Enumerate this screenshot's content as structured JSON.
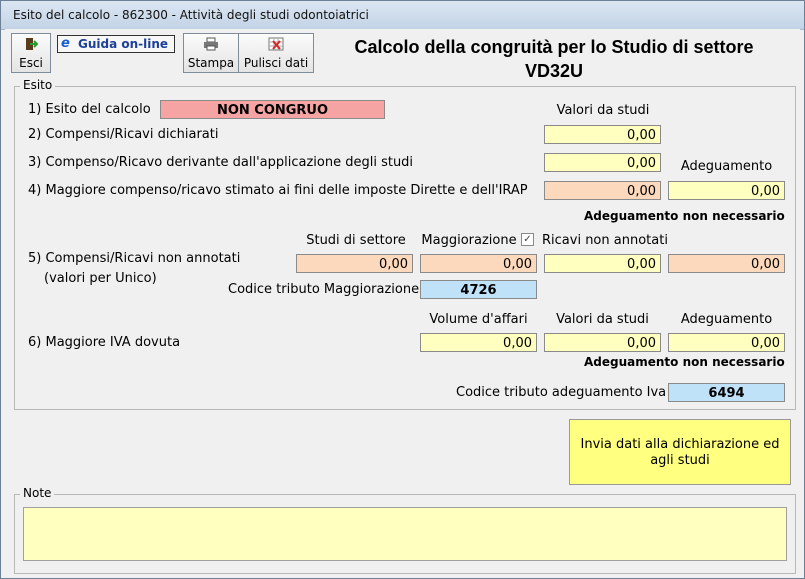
{
  "window": {
    "title": "Esito del calcolo - 862300 - Attività degli studi odontoiatrici"
  },
  "toolbar": {
    "exit_label": "Esci",
    "guide_label": "Guida on-line",
    "print_label": "Stampa",
    "clear_label": "Pulisci dati"
  },
  "heading": {
    "line1": "Calcolo della congruità per lo Studio di settore",
    "line2": "VD32U"
  },
  "esito": {
    "legend": "Esito",
    "row1": {
      "label": "1) Esito del calcolo",
      "value": "NON CONGRUO"
    },
    "valori_header": "Valori da studi",
    "row2": {
      "label": "2) Compensi/Ricavi dichiarati",
      "value": "0,00"
    },
    "row3": {
      "label": "3) Compenso/Ricavo derivante dall'applicazione degli studi",
      "value": "0,00"
    },
    "adeguamento_header": "Adeguamento",
    "row4": {
      "label": "4) Maggiore compenso/ricavo stimato ai fini delle imposte Dirette e dell'IRAP",
      "value": "0,00",
      "adeguamento": "0,00"
    },
    "note_row4": "Adeguamento non necessario",
    "row5": {
      "label_line1": "5) Compensi/Ricavi non annotati",
      "label_line2": "(valori per Unico)",
      "headers": [
        "Studi di settore",
        "Maggiorazione",
        "Ricavi non annotati"
      ],
      "maggiorazione_checked": true,
      "values": [
        "0,00",
        "0,00",
        "0,00",
        "0,00"
      ],
      "codice_label": "Codice tributo Maggiorazione",
      "codice_value": "4726"
    },
    "row6": {
      "label": "6) Maggiore IVA dovuta",
      "headers": [
        "Volume d'affari",
        "Valori da studi",
        "Adeguamento"
      ],
      "values": [
        "0,00",
        "0,00",
        "0,00"
      ],
      "note": "Adeguamento non necessario",
      "codice_label": "Codice tributo adeguamento Iva",
      "codice_value": "6494"
    }
  },
  "send_button": {
    "line1": "Invia dati alla dichiarazione ed",
    "line2": "agli studi"
  },
  "notes": {
    "legend": "Note",
    "value": ""
  }
}
